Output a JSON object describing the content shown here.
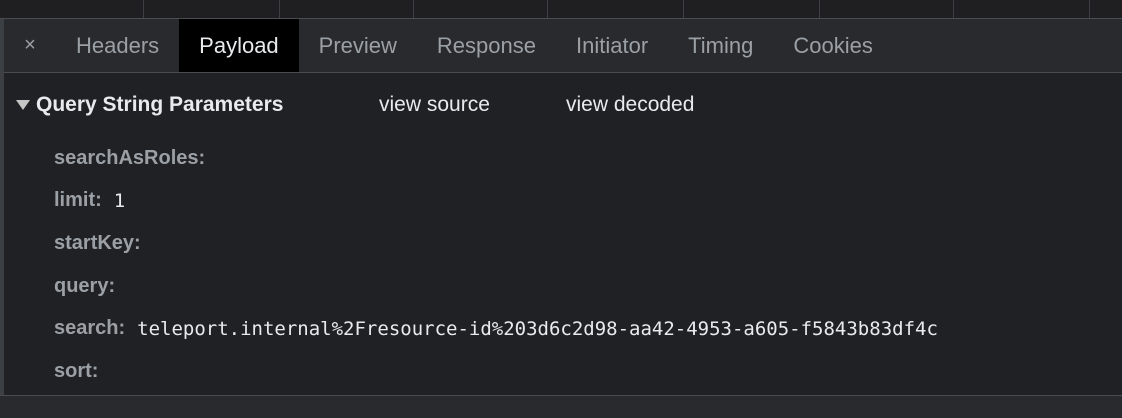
{
  "tabs": {
    "close_label": "×",
    "items": [
      {
        "label": "Headers",
        "active": false
      },
      {
        "label": "Payload",
        "active": true
      },
      {
        "label": "Preview",
        "active": false
      },
      {
        "label": "Response",
        "active": false
      },
      {
        "label": "Initiator",
        "active": false
      },
      {
        "label": "Timing",
        "active": false
      },
      {
        "label": "Cookies",
        "active": false
      }
    ]
  },
  "section": {
    "title": "Query String Parameters",
    "view_source": "view source",
    "view_decoded": "view decoded"
  },
  "params": [
    {
      "key": "searchAsRoles:",
      "value": ""
    },
    {
      "key": "limit:",
      "value": "1"
    },
    {
      "key": "startKey:",
      "value": ""
    },
    {
      "key": "query:",
      "value": ""
    },
    {
      "key": "search:",
      "value": "teleport.internal%2Fresource-id%203d6c2d98-aa42-4953-a605-f5843b83df4c"
    },
    {
      "key": "sort:",
      "value": ""
    }
  ],
  "colors": {
    "background": "#202124",
    "tabbar": "#292a2d",
    "active_tab": "#000000",
    "text_primary": "#e8eaed",
    "text_secondary": "#9aa0a6"
  }
}
